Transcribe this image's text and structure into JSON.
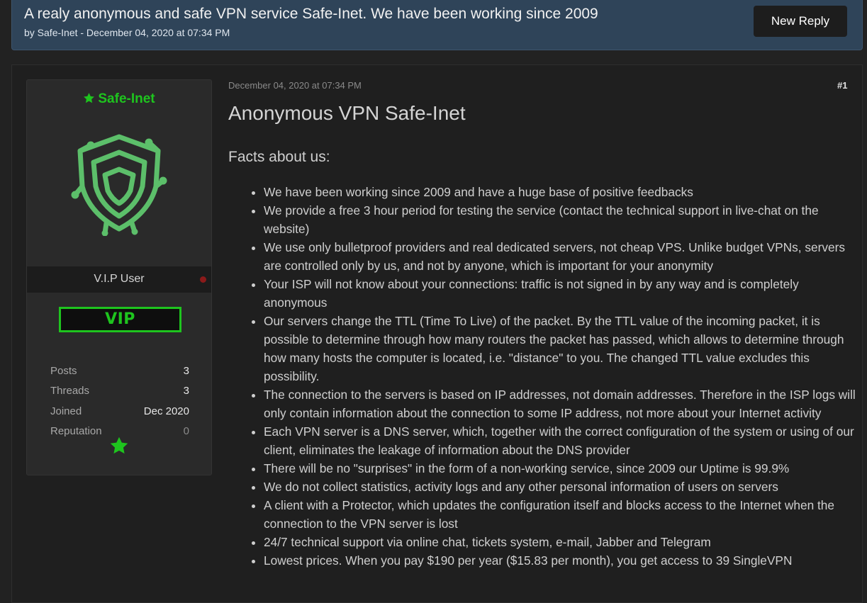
{
  "thread": {
    "title": "A realy anonymous and safe VPN service Safe-Inet. We have been working since 2009",
    "meta": "by Safe-Inet - December 04, 2020 at 07:34 PM",
    "new_reply_label": "New Reply"
  },
  "user": {
    "name": "Safe-Inet",
    "title": "V.I.P User",
    "badge": "VIP",
    "stats": [
      {
        "label": "Posts",
        "value": "3"
      },
      {
        "label": "Threads",
        "value": "3"
      },
      {
        "label": "Joined",
        "value": "Dec 2020"
      },
      {
        "label": "Reputation",
        "value": "0"
      }
    ],
    "colors": {
      "name": "#1ec41e",
      "status_offline": "#8b1a1a"
    }
  },
  "post": {
    "date": "December 04, 2020 at 07:34 PM",
    "number": "#1",
    "heading": "Anonymous VPN Safe-Inet",
    "subheading": "Facts about us:",
    "facts": [
      "We have been working since 2009 and have a huge base of positive feedbacks",
      "We provide a free 3 hour period for testing the service (contact the technical support in live-chat on the website)",
      "We use only bulletproof providers and real dedicated servers, not cheap VPS. Unlike budget VPNs, servers are controlled only by us, and not by anyone, which is important for your anonymity",
      "Your ISP will not know about your connections: traffic is not signed in by any way and is completely anonymous",
      "Our servers change the TTL (Time To Live) of the packet. By the TTL value of the incoming packet, it is possible to determine through how many routers the packet has passed, which allows to determine through how many hosts the computer is located, i.e. \"distance\" to you. The changed TTL value excludes this possibility.",
      "The connection to the servers is based on IP addresses, not domain addresses. Therefore in the ISP logs will only contain information about the connection to some IP address, not more about your Internet activity",
      "Each VPN server is a DNS server, which, together with the correct configuration of the system or using of our client, eliminates the leakage of information about the DNS provider",
      "There will be no \"surprises\" in the form of a non-working service, since 2009 our Uptime is 99.9%",
      "We do not collect statistics, activity logs and any other personal information of users on servers",
      "A client with a Protector, which updates the configuration itself and blocks access to the Internet when the connection to the VPN server is lost",
      "24/7 technical support via online chat, tickets system, e-mail, Jabber and Telegram",
      "Lowest prices. When you pay $190 per year ($15.83 per month), you get access to 39 SingleVPN"
    ]
  }
}
